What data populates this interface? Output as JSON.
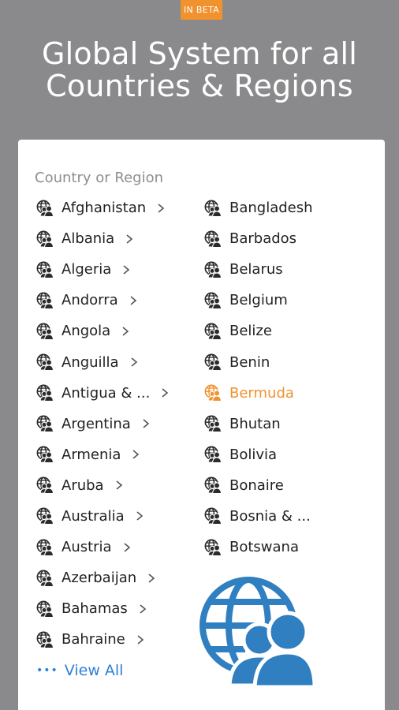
{
  "badge": "IN BETA",
  "headline": {
    "line1": "Global System for all",
    "line2": "Countries & Regions"
  },
  "card": {
    "section_label": "Country or Region",
    "left_items": [
      {
        "label": "Afghanistan"
      },
      {
        "label": "Albania"
      },
      {
        "label": "Algeria"
      },
      {
        "label": "Andorra"
      },
      {
        "label": "Angola"
      },
      {
        "label": "Anguilla"
      },
      {
        "label": "Antigua & ..."
      },
      {
        "label": "Argentina"
      },
      {
        "label": "Armenia"
      },
      {
        "label": "Aruba"
      },
      {
        "label": "Australia"
      },
      {
        "label": "Austria"
      },
      {
        "label": "Azerbaijan"
      },
      {
        "label": "Bahamas"
      },
      {
        "label": "Bahraine"
      }
    ],
    "right_items": [
      {
        "label": "Bangladesh"
      },
      {
        "label": "Barbados"
      },
      {
        "label": "Belarus"
      },
      {
        "label": "Belgium"
      },
      {
        "label": "Belize"
      },
      {
        "label": "Benin"
      },
      {
        "label": "Bermuda",
        "selected": true
      },
      {
        "label": "Bhutan"
      },
      {
        "label": "Bolivia"
      },
      {
        "label": "Bonaire"
      },
      {
        "label": "Bosnia & ..."
      },
      {
        "label": "Botswana"
      }
    ],
    "view_all": "View All"
  },
  "colors": {
    "background": "#8a8a8c",
    "accent": "#f0922e",
    "link": "#2f7fd6",
    "illustration": "#2f7fc1"
  },
  "icons": {
    "row": "globe-people-icon",
    "chevron": "chevron-right-icon",
    "illustration": "global-users-icon"
  }
}
